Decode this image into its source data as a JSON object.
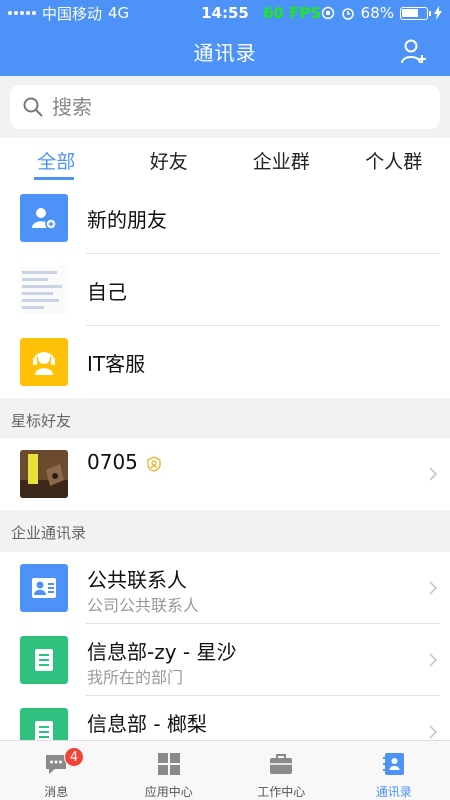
{
  "status": {
    "carrier": "中国移动",
    "network": "4G",
    "time": "14:55",
    "fps": "60 FPS",
    "battery": "68%",
    "battery_level": 0.68
  },
  "nav": {
    "title": "通讯录"
  },
  "search": {
    "placeholder": "搜索"
  },
  "tabs": [
    {
      "label": "全部"
    },
    {
      "label": "好友"
    },
    {
      "label": "企业群"
    },
    {
      "label": "个人群"
    }
  ],
  "top_items": [
    {
      "title": "新的朋友",
      "icon": "add-friend-icon"
    },
    {
      "title": "自己",
      "icon": "self-thumbnail"
    },
    {
      "title": "IT客服",
      "icon": "customer-service-icon"
    }
  ],
  "sections": {
    "starred": "星标好友",
    "enterprise": "企业通讯录"
  },
  "starred_items": [
    {
      "title": "0705",
      "icon": "contact-photo"
    }
  ],
  "enterprise_items": [
    {
      "title": "公共联系人",
      "subtitle": "公司公共联系人",
      "icon": "public-contacts-icon"
    },
    {
      "title": "信息部-zy - 星沙",
      "subtitle": "我所在的部门",
      "icon": "department-icon"
    },
    {
      "title": "信息部 - 榔梨",
      "subtitle": "",
      "icon": "department-icon"
    }
  ],
  "tabbar": [
    {
      "label": "消息",
      "badge": "4",
      "icon": "message-icon"
    },
    {
      "label": "应用中心",
      "icon": "apps-grid-icon"
    },
    {
      "label": "工作中心",
      "icon": "briefcase-icon"
    },
    {
      "label": "通讯录",
      "icon": "contacts-book-icon"
    }
  ],
  "colors": {
    "primary": "#4d93f7",
    "teal": "#2ec27e",
    "yellow": "#ffc107",
    "fps_green": "#1ee81e",
    "badge_red": "#f44336"
  }
}
